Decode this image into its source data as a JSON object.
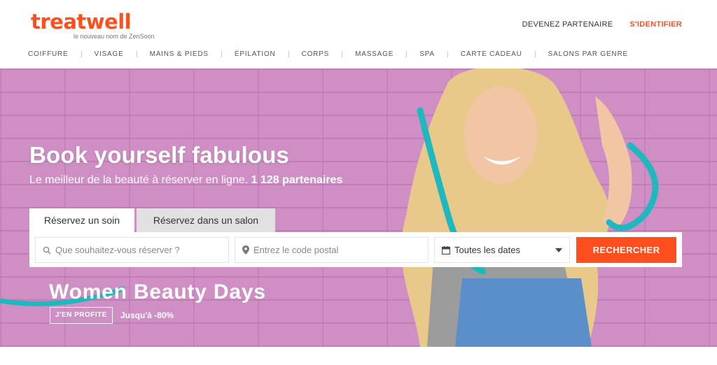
{
  "brand": {
    "logo": "treatwell",
    "tagline": "le nouveau nom de ZenSoon",
    "accent_color": "#ff4f1f",
    "teal_color": "#1fb8bf"
  },
  "top_links": {
    "partner": "DEVENEZ PARTENAIRE",
    "signin": "S'IDENTIFIER"
  },
  "nav": [
    "COIFFURE",
    "VISAGE",
    "MAINS & PIEDS",
    "ÉPILATION",
    "CORPS",
    "MASSAGE",
    "SPA",
    "CARTE CADEAU",
    "SALONS PAR GENRE"
  ],
  "hero": {
    "title": "Book yourself fabulous",
    "subtitle": "Le meilleur de la beauté à réserver en ligne.",
    "partners": "1 128 partenaires"
  },
  "booking": {
    "tab_active": "Réservez un soin",
    "tab_inactive": "Réservez dans un salon",
    "what_placeholder": "Que souhaitez-vous réserver ?",
    "zip_placeholder": "Entrez le code postal",
    "date_value": "Toutes les dates",
    "search_label": "RECHERCHER",
    "icons": {
      "what": "search-icon",
      "zip": "map-pin-icon",
      "date": "calendar-icon"
    }
  },
  "promo": {
    "title": "Women Beauty Days",
    "cta": "J'EN PROFITE",
    "discount": "Jusqu'à -80%"
  }
}
